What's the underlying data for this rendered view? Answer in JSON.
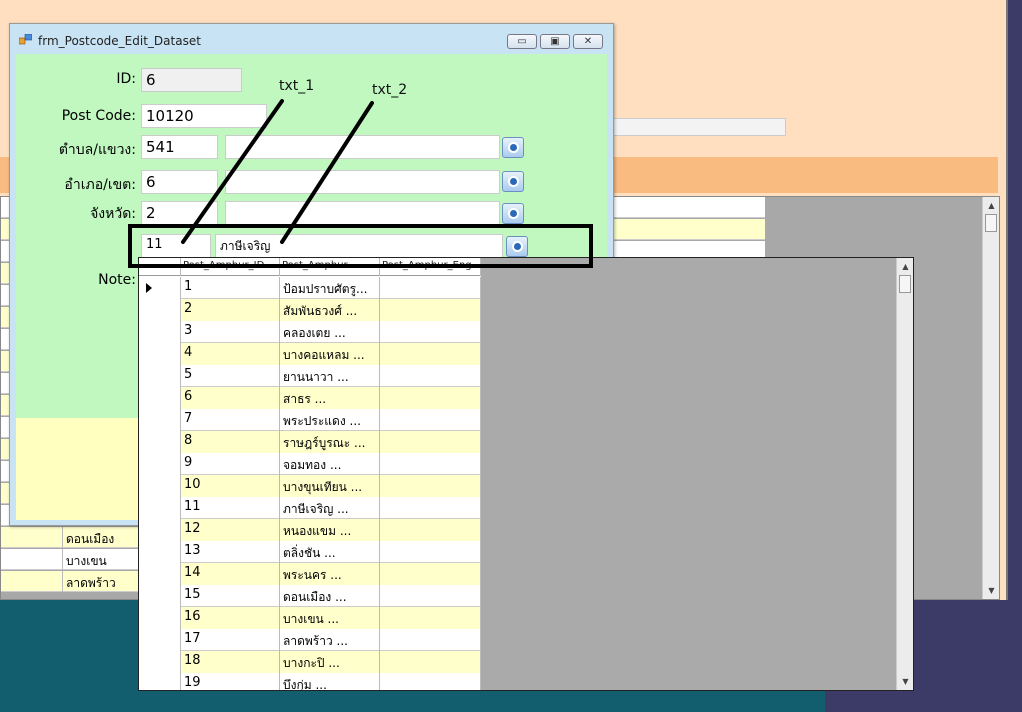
{
  "window": {
    "title": "frm_Postcode_Edit_Dataset",
    "buttons": {
      "minimize": "▭",
      "maximize": "▣",
      "close": "✕"
    }
  },
  "form": {
    "id": {
      "label": "ID:",
      "value": "6"
    },
    "postcode": {
      "label": "Post Code:",
      "value": "10120"
    },
    "tambon": {
      "label": "ตำบล/แขวง:",
      "code": "541",
      "name": ""
    },
    "amphur": {
      "label": "อำเภอ/เขต:",
      "code": "6",
      "name": ""
    },
    "province": {
      "label": "จังหวัด:",
      "code": "2",
      "name": ""
    },
    "amphur_pick": {
      "code": "11",
      "name": "ภาษีเจริญ"
    },
    "note": {
      "label": "Note:"
    }
  },
  "annotations": {
    "txt1": "txt_1",
    "txt2": "txt_2"
  },
  "dropdown_grid": {
    "columns": [
      "Post_Amphur_ID",
      "Post_Amphur",
      "Post_Amphur_Eng"
    ],
    "rows": [
      {
        "id": "1",
        "name": "ป้อมปราบศัตรู..."
      },
      {
        "id": "2",
        "name": "สัมพันธวงศ์ ..."
      },
      {
        "id": "3",
        "name": "คลองเตย ..."
      },
      {
        "id": "4",
        "name": "บางคอแหลม ..."
      },
      {
        "id": "5",
        "name": "ยานนาวา ..."
      },
      {
        "id": "6",
        "name": "สาธร ..."
      },
      {
        "id": "7",
        "name": "พระประแดง ..."
      },
      {
        "id": "8",
        "name": "ราษฎร์บูรณะ ..."
      },
      {
        "id": "9",
        "name": "จอมทอง ..."
      },
      {
        "id": "10",
        "name": "บางขุนเทียน ..."
      },
      {
        "id": "11",
        "name": "ภาษีเจริญ ..."
      },
      {
        "id": "12",
        "name": "หนองแขม ..."
      },
      {
        "id": "13",
        "name": "ตลิ่งชัน ..."
      },
      {
        "id": "14",
        "name": "พระนคร ..."
      },
      {
        "id": "15",
        "name": "ดอนเมือง ..."
      },
      {
        "id": "16",
        "name": "บางเขน ..."
      },
      {
        "id": "17",
        "name": "ลาดพร้าว ..."
      },
      {
        "id": "18",
        "name": "บางกะปิ ..."
      },
      {
        "id": "19",
        "name": "บึงกุ่ม ..."
      }
    ]
  },
  "background_grid": {
    "rows": [
      "",
      "",
      "",
      "",
      "",
      "",
      "",
      "",
      "",
      "",
      "",
      "",
      "",
      "",
      "",
      "ดอนเมือง",
      "บางเขน",
      "ลาดพร้าว"
    ]
  }
}
